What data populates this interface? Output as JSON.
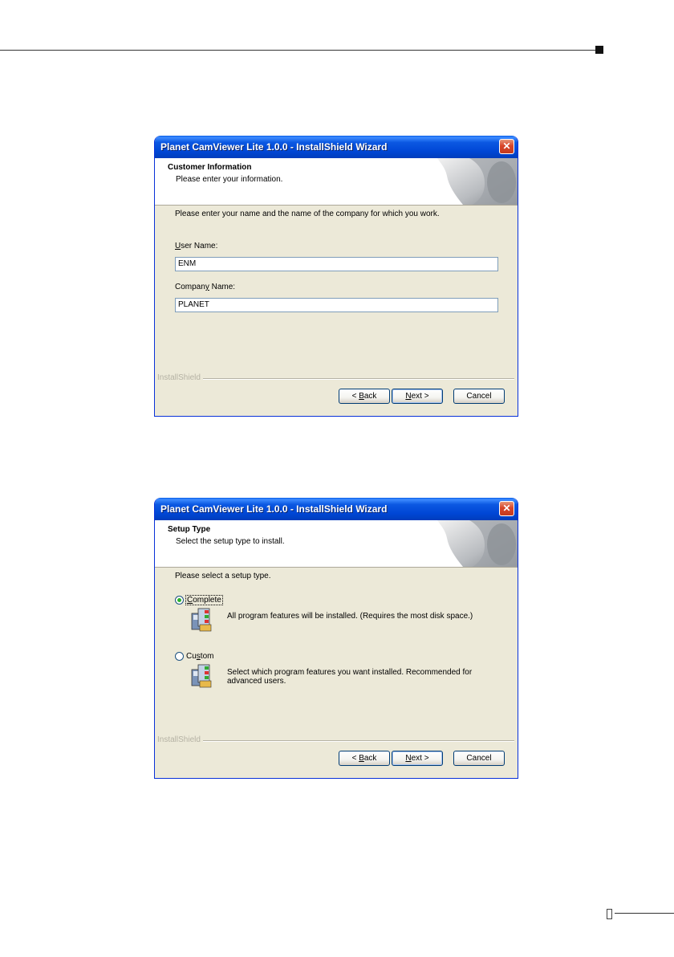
{
  "colors": {
    "titlebar": "#0046d5",
    "dialog_bg": "#ece9d8",
    "close": "#d8452a"
  },
  "dialogs": [
    {
      "title": "Planet CamViewer Lite 1.0.0 - InstallShield Wizard",
      "header_title": "Customer Information",
      "header_subtitle": "Please enter your information.",
      "instruction": "Please enter your name and the name of the company for which you work.",
      "user_name_label_u": "U",
      "user_name_label_rest": "ser Name:",
      "user_name_value": "ENM",
      "company_label_pre": "Compan",
      "company_label_u": "y",
      "company_label_rest": " Name:",
      "company_value": "PLANET",
      "brand": "InstallShield",
      "back_pre": "< ",
      "back_u": "B",
      "back_rest": "ack",
      "next_u": "N",
      "next_rest": "ext >",
      "cancel": "Cancel"
    },
    {
      "title": "Planet CamViewer Lite 1.0.0 - InstallShield Wizard",
      "header_title": "Setup Type",
      "header_subtitle": "Select the setup type to install.",
      "instruction": "Please select a setup type.",
      "option1_u": "C",
      "option1_rest": "omplete",
      "option1_desc": "All program features will be installed. (Requires the most disk space.)",
      "option1_selected": true,
      "option2_pre": "Cu",
      "option2_u": "s",
      "option2_rest": "tom",
      "option2_desc": "Select which program features you want installed. Recommended for advanced users.",
      "brand": "InstallShield",
      "back_pre": "< ",
      "back_u": "B",
      "back_rest": "ack",
      "next_u": "N",
      "next_rest": "ext >",
      "cancel": "Cancel"
    }
  ]
}
